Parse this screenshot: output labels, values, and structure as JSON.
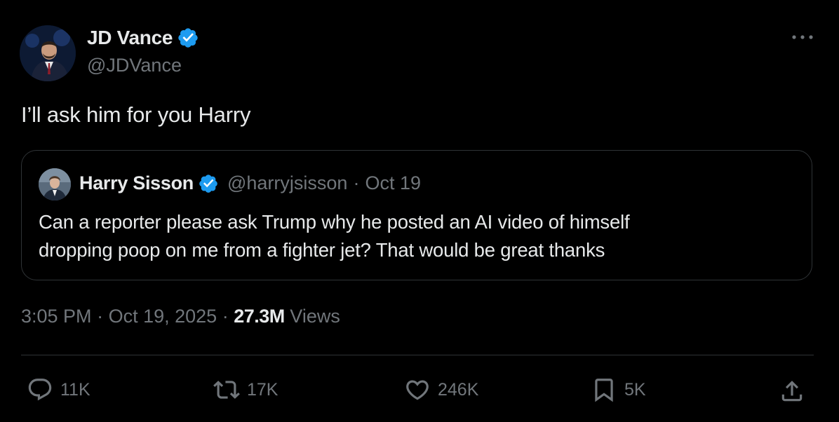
{
  "author": {
    "name": "JD Vance",
    "handle": "@JDVance",
    "verified": true,
    "avatar_icon": "profile-photo"
  },
  "tweet": {
    "text": "I’ll ask him for you Harry"
  },
  "quoted": {
    "name": "Harry Sisson",
    "handle": "@harryjsisson",
    "date": "Oct 19",
    "separator": "·",
    "verified": true,
    "text_line1": "Can a reporter please ask Trump why he posted an AI video of himself",
    "text_line2": "dropping poop on me from a fighter jet? That would be great thanks"
  },
  "meta": {
    "time": "3:05 PM",
    "date": "Oct 19, 2025",
    "separator": "·",
    "views_count": "27.3M",
    "views_label": "Views"
  },
  "actions": {
    "replies": "11K",
    "reposts": "17K",
    "likes": "246K",
    "bookmarks": "5K"
  },
  "colors": {
    "background": "#000000",
    "text": "#e7e9ea",
    "muted": "#71767b",
    "border": "#2f3336",
    "verified_badge": "#1d9bf0"
  },
  "icons": [
    "verified-badge-icon",
    "more-icon",
    "reply-icon",
    "repost-icon",
    "like-icon",
    "bookmark-icon",
    "share-icon"
  ]
}
